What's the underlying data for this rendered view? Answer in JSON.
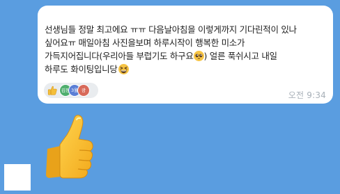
{
  "message": {
    "lines": [
      "선생님들 정말 최고에요 ㅠㅠ 다음날아침을 이렇게까지 기다린적이 있나",
      "싶어요ㅠ 매일아침 사진을보며 하루시작이 행복한 미소가",
      "가득지어집니다(우리아들 부럽기도 하구요",
      ") 얼른 푹쉬시고 내일",
      "하루도 화이팅입니당"
    ],
    "time": "오전 9:34"
  },
  "reactions": {
    "avatars": [
      {
        "label": "김정",
        "color": "#4fae6e"
      },
      {
        "label": "3월",
        "color": "#5b7fd6"
      },
      {
        "label": "광",
        "color": "#d86a5a"
      }
    ]
  },
  "colors": {
    "background": "#5a9de0",
    "bubble": "#ffffff",
    "emoji": "#f6c445"
  },
  "icons": {
    "inline_emoji_1": "pleading-face-icon",
    "inline_emoji_2": "grinning-squinting-face-icon",
    "reaction": "thumbs-up-icon",
    "sticker": "thumbs-up-sticker"
  }
}
